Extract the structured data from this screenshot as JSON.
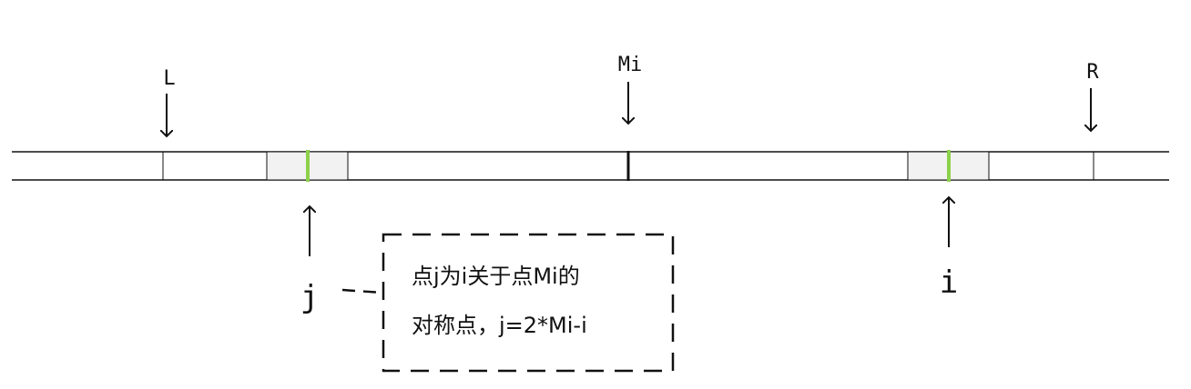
{
  "labels": {
    "left": "L",
    "middle": "Mi",
    "right": "R",
    "j": "j",
    "i": "i"
  },
  "note": {
    "line1": "点j为i关于点Mi的",
    "line2": "对称点，j=2*Mi-i"
  },
  "colors": {
    "highlight": "#8dd14a",
    "cell_fill": "#f2f2f2",
    "line": "#111111"
  }
}
